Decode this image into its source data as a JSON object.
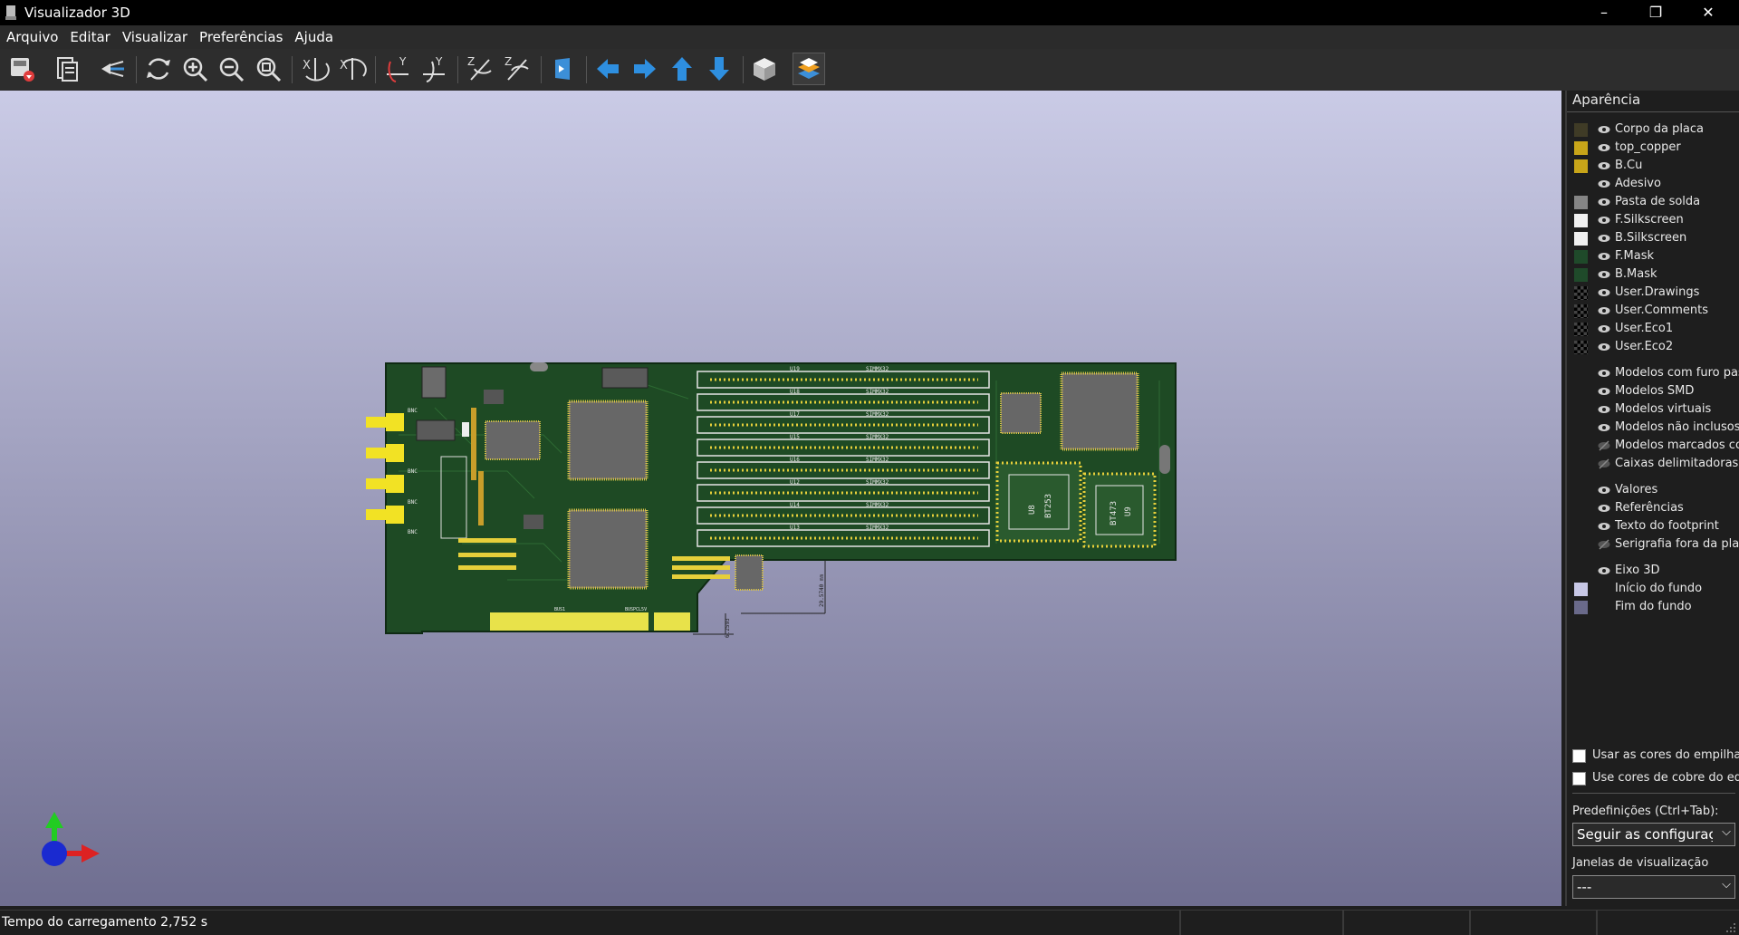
{
  "window": {
    "title": "Visualizador 3D"
  },
  "menu": [
    "Arquivo",
    "Editar",
    "Visualizar",
    "Preferências",
    "Ajuda"
  ],
  "toolbar": {
    "buttons": [
      "export-image",
      "copy-clipboard",
      "raytracing",
      "reload",
      "zoom-in",
      "zoom-out",
      "zoom-fit",
      "rotate-x-cw",
      "rotate-x-ccw",
      "rotate-y-cw",
      "rotate-y-ccw",
      "rotate-z-cw",
      "rotate-z-ccw",
      "flip-board",
      "pan-left",
      "pan-right",
      "pan-up",
      "pan-down",
      "orthographic",
      "layers-manager"
    ]
  },
  "board": {
    "slot_refs": [
      "U19",
      "U18",
      "U17",
      "U15",
      "U16",
      "U12",
      "U14",
      "U13"
    ],
    "slot_value": "SIMMX32",
    "chip_u8": [
      "U8",
      "BT253"
    ],
    "chip_u9": [
      "BT473",
      "U9"
    ],
    "dimension_1": "29.5740 mm",
    "dimension_2": "6.2593",
    "connector_labels": [
      "BNC",
      "BNC",
      "BNC",
      "BNC"
    ],
    "edge_label_1": "BUS1",
    "edge_label_2": "BUSPCL5V"
  },
  "appearance": {
    "header": "Aparência",
    "layers": [
      {
        "name": "Corpo da placa",
        "color": "#3f3b26"
      },
      {
        "name": "top_copper",
        "color": "#c8a519"
      },
      {
        "name": "B.Cu",
        "color": "#c8a519"
      },
      {
        "name": "Adesivo",
        "color": ""
      },
      {
        "name": "Pasta de solda",
        "color": "#858585"
      },
      {
        "name": "F.Silkscreen",
        "color": "#f0f0f0"
      },
      {
        "name": "B.Silkscreen",
        "color": "#f0f0f0"
      },
      {
        "name": "F.Mask",
        "color": "#1f4a2a"
      },
      {
        "name": "B.Mask",
        "color": "#1f4a2a"
      },
      {
        "name": "User.Drawings",
        "color": "checker"
      },
      {
        "name": "User.Comments",
        "color": "checker"
      },
      {
        "name": "User.Eco1",
        "color": "checker"
      },
      {
        "name": "User.Eco2",
        "color": "checker"
      }
    ],
    "objects": [
      {
        "name": "Modelos com furo pas",
        "visible": true
      },
      {
        "name": "Modelos SMD",
        "visible": true
      },
      {
        "name": "Modelos virtuais",
        "visible": true
      },
      {
        "name": "Modelos não inclusos",
        "visible": true
      },
      {
        "name": "Modelos marcados co",
        "visible": false
      },
      {
        "name": "Caixas delimitadoras d",
        "visible": false
      }
    ],
    "texts": [
      {
        "name": "Valores",
        "visible": true
      },
      {
        "name": "Referências",
        "visible": true
      },
      {
        "name": "Texto do footprint",
        "visible": true
      },
      {
        "name": "Serigrafia fora da placa",
        "visible": false
      }
    ],
    "extras": [
      {
        "name": "Eixo 3D",
        "color": ""
      },
      {
        "name": "Início do fundo",
        "color": "#c8c8e6"
      },
      {
        "name": "Fim do fundo",
        "color": "#6a6a8a"
      }
    ],
    "checkbox_1": "Usar as cores do empilham",
    "checkbox_2": "Use cores de cobre do edit",
    "presets_label": "Predefinições (Ctrl+Tab):",
    "presets_value": "Seguir as configuraçõe",
    "viewports_label": "Janelas de visualização",
    "viewports_value": "---"
  },
  "status": {
    "text": "Tempo do carregamento 2,752 s"
  }
}
